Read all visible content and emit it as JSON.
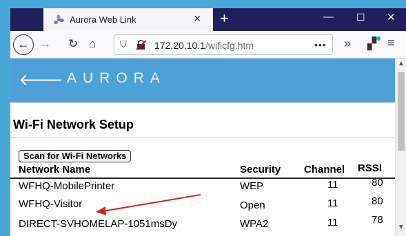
{
  "browser": {
    "tab_title": "Aurora Web Link",
    "tab_close_glyph": "×",
    "new_tab_glyph": "+",
    "window_controls": {
      "minimize": "—",
      "maximize": "☐",
      "close": "✕"
    },
    "url_host": "172.20.10.1",
    "url_path": "/wificfg.htm",
    "url_more": "•••",
    "overflow_glyph": "»",
    "menu_glyph": "≡",
    "icons": [
      "fan-icon",
      "back-icon",
      "forward-icon",
      "reload-icon",
      "home-icon",
      "shield-icon",
      "insecure-lock-icon",
      "extensions-icon",
      "menu-icon"
    ]
  },
  "app": {
    "logo": "AURORA",
    "back_glyph": "🡐",
    "page_title": "Wi-Fi Network Setup",
    "scan_button": "Scan for Wi-Fi Networks"
  },
  "table": {
    "columns": [
      "Network Name",
      "Security",
      "Channel",
      "RSSI"
    ],
    "rows": [
      {
        "name": "WFHQ-MobilePrinter",
        "security": "WEP",
        "channel": "11",
        "rssi": "80"
      },
      {
        "name": "WFHQ-Visitor",
        "security": "Open",
        "channel": "11",
        "rssi": "80"
      },
      {
        "name": "DIRECT-SVHOMELAP-1051msDy",
        "security": "WPA2",
        "channel": "11",
        "rssi": "78"
      }
    ]
  },
  "colors": {
    "taskbar_bg": "#1f1f5e",
    "app_header": "#4f9fd9",
    "frame_bg": "#4aa8d8",
    "annotation_arrow": "#e02020"
  }
}
